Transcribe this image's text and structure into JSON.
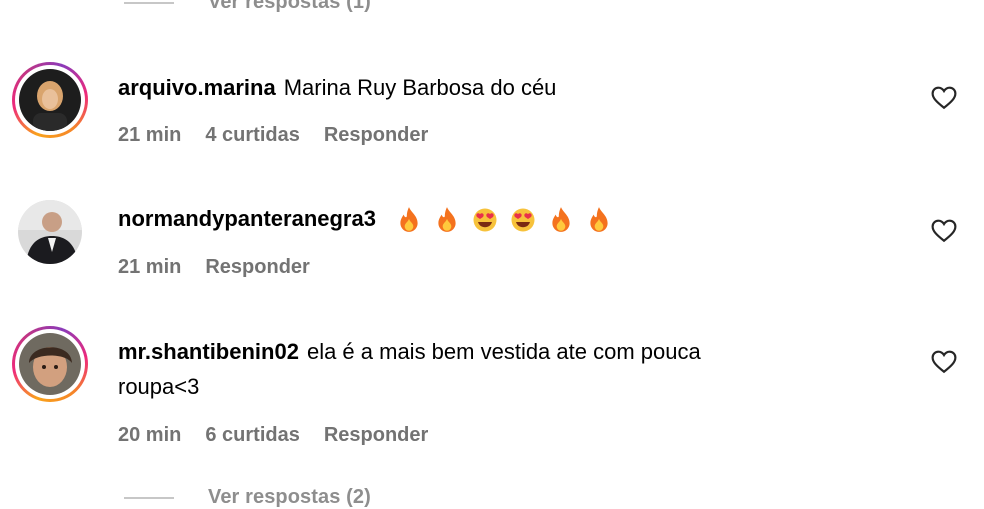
{
  "replies_top": {
    "label": "Ver respostas (1)"
  },
  "replies_bottom": {
    "label": "Ver respostas (2)"
  },
  "comments": [
    {
      "username": "arquivo.marina",
      "text": "Marina Ruy Barbosa do céu",
      "time": "21 min",
      "likes": "4 curtidas",
      "reply": "Responder"
    },
    {
      "username": "normandypanteranegra3",
      "emojis": [
        "fire-emoji",
        "fire-emoji",
        "heart-eyes-emoji",
        "heart-eyes-emoji",
        "fire-emoji",
        "fire-emoji"
      ],
      "time": "21 min",
      "reply": "Responder"
    },
    {
      "username": "mr.shantibenin02",
      "text_line1": "ela é a mais bem vestida ate com pouca",
      "text_line2": "roupa<3",
      "time": "20 min",
      "likes": "6 curtidas",
      "reply": "Responder"
    }
  ],
  "colors": {
    "meta": "#737373",
    "muted": "#8e8e8e",
    "ring_start": "#f9a21b",
    "ring_end": "#c13584"
  }
}
